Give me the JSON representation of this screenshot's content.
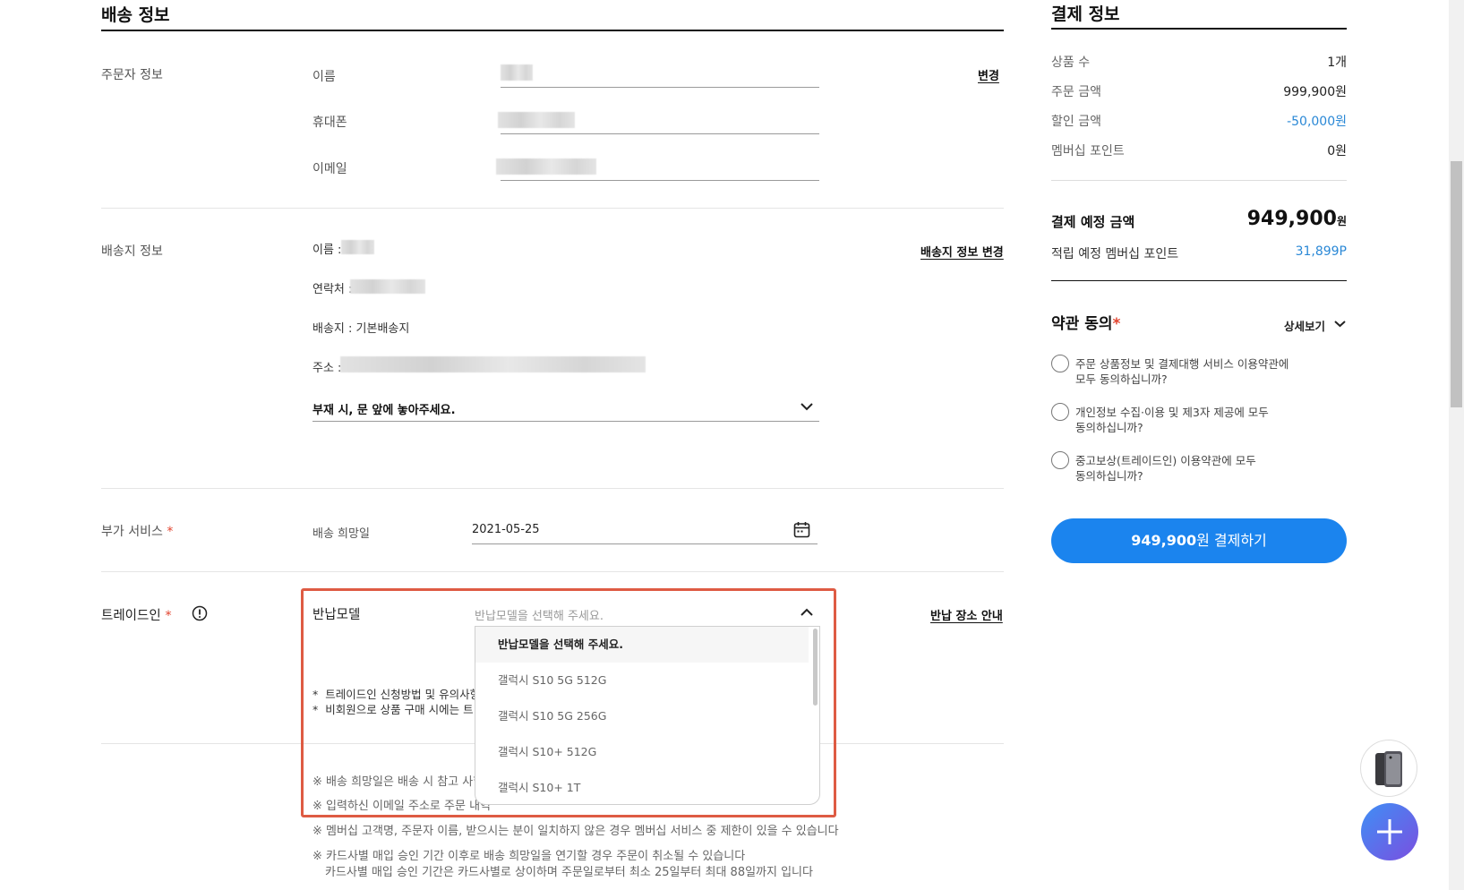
{
  "shipping": {
    "title": "배송 정보",
    "orderer": {
      "section_label": "주문자 정보",
      "name_label": "이름",
      "phone_label": "휴대폰",
      "email_label": "이메일",
      "change_link": "변경"
    },
    "destination": {
      "section_label": "배송지 정보",
      "name_label": "이름 :",
      "contact_label": "연락처 :",
      "place_label": "배송지 : 기본배송지",
      "address_label": "주소 :",
      "change_link": "배송지 정보 변경",
      "request_select": "부재 시, 문 앞에 놓아주세요."
    },
    "addon": {
      "section_label": "부가 서비스",
      "required_mark": "*",
      "date_label": "배송 희망일",
      "date_value": "2021-05-25"
    },
    "tradein": {
      "section_label": "트레이드인",
      "required_mark": "*",
      "info_icon": "exclamation-circle-icon",
      "return_model_label": "반납모델",
      "select_placeholder": "반납모델을 선택해 주세요.",
      "location_link": "반납 장소 안내",
      "note1_prefix": "*",
      "note1_visible": "트레이드인 신청방법 및 유의사항",
      "note2_prefix": "*",
      "note2_visible": "비회원으로 상품 구매 시에는 트",
      "options": [
        "반납모델을 선택해 주세요.",
        "갤럭시 S10 5G 512G",
        "갤럭시 S10 5G 256G",
        "갤럭시 S10+ 512G",
        "갤럭시 S10+ 1T"
      ]
    },
    "notes": [
      "※ 배송 희망일은 배송 시 참고 사항",
      "※ 입력하신 이메일 주소로 주문 내역",
      "※ 멤버십 고객명, 주문자 이름, 받으시는 분이 일치하지 않은 경우 멤버십 서비스 중 제한이 있을 수 있습니다",
      "※ 카드사별 매입 승인 기간 이후로 배송 희망일을 연기할 경우 주문이 취소될 수 있습니다",
      "카드사별 매입 승인 기간은 카드사별로 상이하며 주문일로부터 최소 25일부터 최대 88일까지 입니다"
    ]
  },
  "payment": {
    "title": "결제 정보",
    "rows": [
      {
        "label": "상품 수",
        "value": "1개"
      },
      {
        "label": "주문 금액",
        "value": "999,900원"
      },
      {
        "label": "할인 금액",
        "value": "-50,000원"
      },
      {
        "label": "멤버십 포인트",
        "value": "0원"
      }
    ],
    "expected_label": "결제 예정 금액",
    "expected_value": "949,900",
    "expected_unit": "원",
    "points_label": "적립 예정 멤버십 포인트",
    "points_value": "31,899P",
    "accent_color": "#1b84ee",
    "discount_color": "#2a88d6"
  },
  "terms": {
    "title": "약관 동의",
    "required_mark": "*",
    "detail_link": "상세보기",
    "items": [
      {
        "line1": "주문 상품정보 및 결제대행 서비스 이용약관에",
        "line2": "모두 동의하십니까?"
      },
      {
        "line1": "개인정보 수집·이용 및 제3자 제공에 모두",
        "line2": "동의하십니까?"
      },
      {
        "line1": "중고보상(트레이드인) 이용약관에 모두",
        "line2": "동의하십니까?"
      }
    ]
  },
  "pay_button": {
    "amount": "949,900",
    "suffix": "원 결제하기"
  }
}
